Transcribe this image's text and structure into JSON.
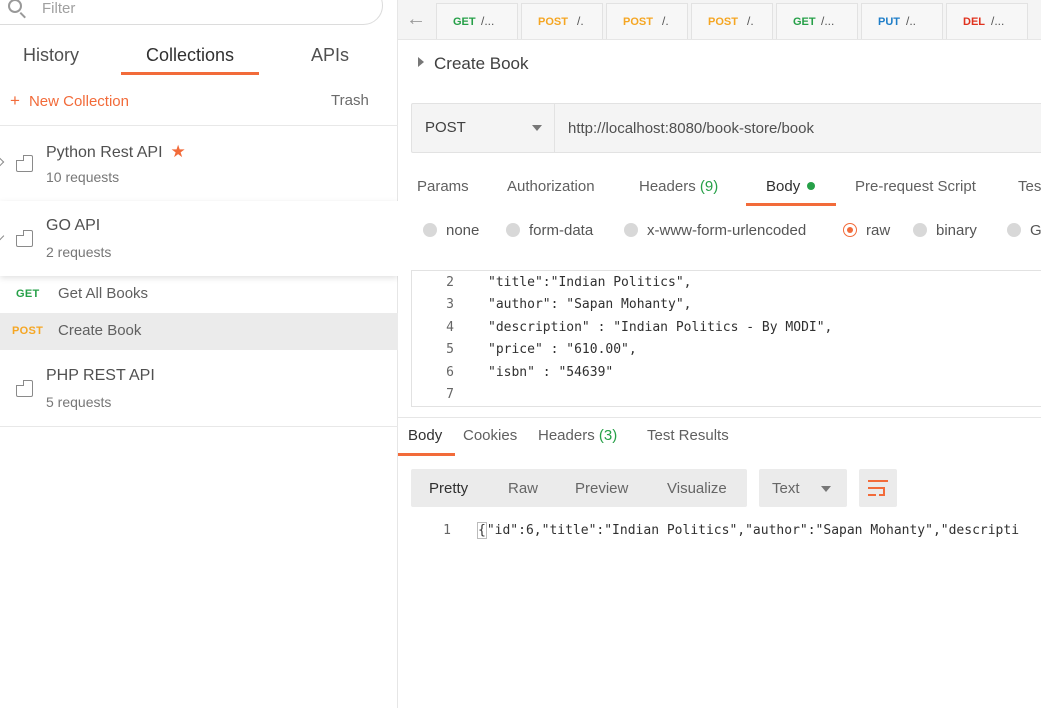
{
  "sidebar": {
    "filter_placeholder": "Filter",
    "tabs": [
      "History",
      "Collections",
      "APIs"
    ],
    "new_collection": "New Collection",
    "trash": "Trash",
    "collections": [
      {
        "name": "Python Rest API",
        "count": "10 requests",
        "starred": true
      },
      {
        "name": "GO API",
        "count": "2 requests"
      },
      {
        "name": "PHP REST API",
        "count": "5 requests"
      }
    ],
    "requests": [
      {
        "method": "GET",
        "name": "Get All Books"
      },
      {
        "method": "POST",
        "name": "Create Book"
      }
    ]
  },
  "tabs": [
    {
      "method": "GET",
      "label": "/..."
    },
    {
      "method": "POST",
      "label": "/."
    },
    {
      "method": "POST",
      "label": "/."
    },
    {
      "method": "POST",
      "label": "/."
    },
    {
      "method": "GET",
      "label": "/..."
    },
    {
      "method": "PUT",
      "label": "/.."
    },
    {
      "method": "DEL",
      "label": "/..."
    }
  ],
  "request": {
    "title": "Create Book",
    "method": "POST",
    "url": "http://localhost:8080/book-store/book",
    "subtabs": [
      "Params",
      "Authorization",
      "Headers",
      "(9)",
      "Body",
      "Pre-request Script",
      "Tes"
    ],
    "body_types": [
      "none",
      "form-data",
      "x-www-form-urlencoded",
      "raw",
      "binary",
      "G"
    ],
    "body_lines": [
      {
        "n": "2",
        "text": "\"title\":\"Indian Politics\","
      },
      {
        "n": "3",
        "text": "\"author\": \"Sapan Mohanty\","
      },
      {
        "n": "4",
        "text": "\"description\" : \"Indian Politics - By MODI\","
      },
      {
        "n": "5",
        "text": "\"price\" : \"610.00\","
      },
      {
        "n": "6",
        "text": "\"isbn\" : \"54639\""
      },
      {
        "n": "7",
        "text": ""
      }
    ]
  },
  "response": {
    "tabs": [
      "Body",
      "Cookies",
      "Headers",
      "(3)",
      "Test Results"
    ],
    "formats": [
      "Pretty",
      "Raw",
      "Preview",
      "Visualize"
    ],
    "type": "Text",
    "line_number": "1",
    "brace": "{",
    "line": "\"id\":6,\"title\":\"Indian Politics\",\"author\":\"Sapan Mohanty\",\"descripti"
  },
  "colors": {
    "accent": "#f26b3a",
    "get": "#26a048",
    "post": "#f5a623",
    "put": "#1f7ec8",
    "del": "#e0321e"
  }
}
